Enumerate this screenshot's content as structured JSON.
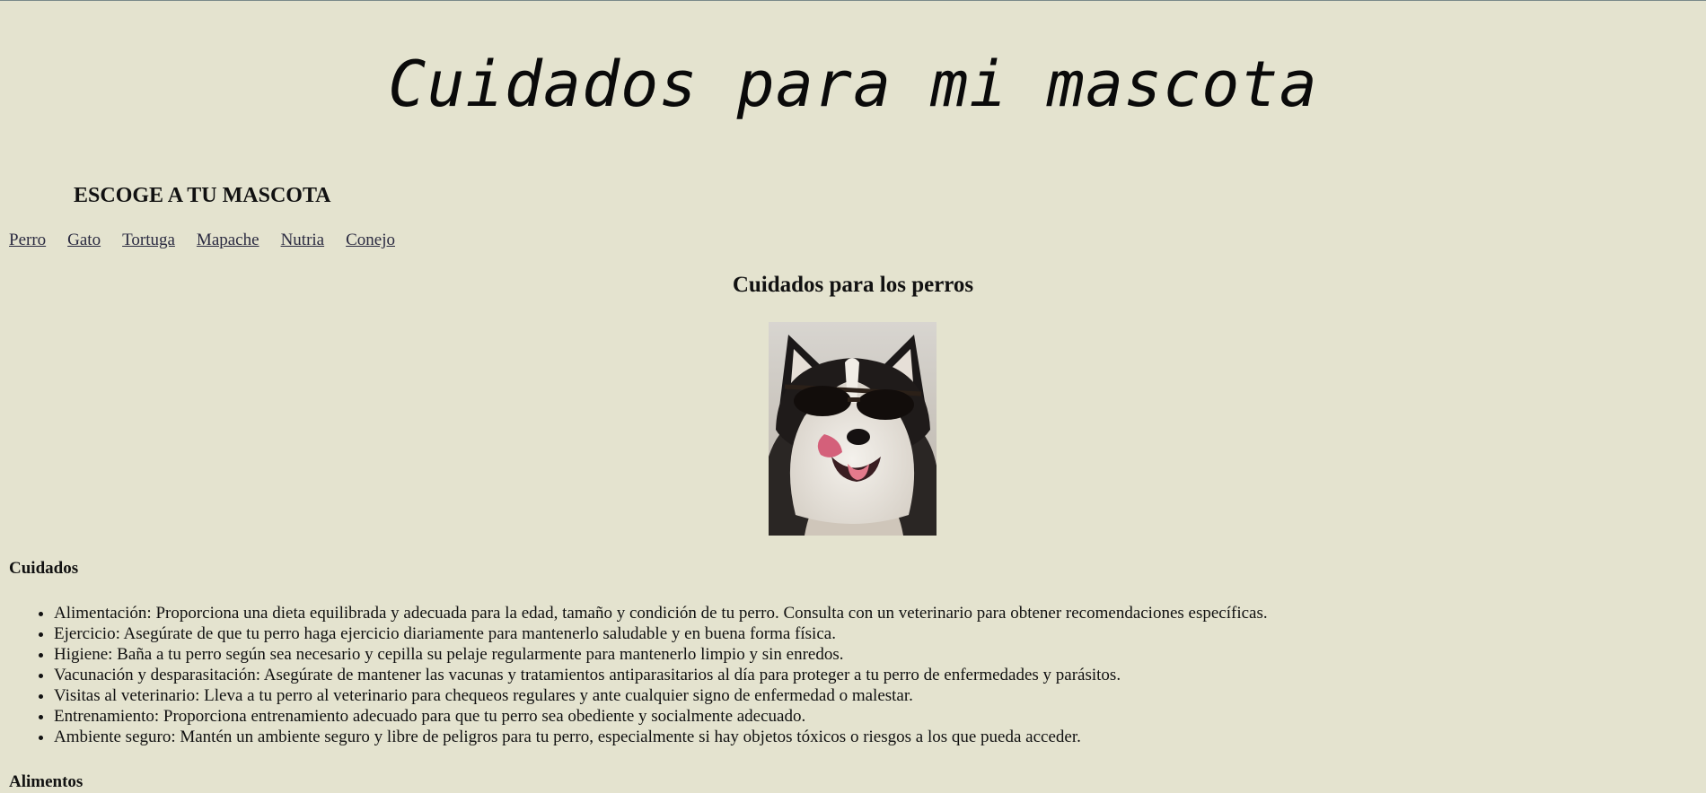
{
  "header": {
    "title": "Cuidados para mi mascota"
  },
  "chooser": {
    "heading": "ESCOGE A TU MASCOTA",
    "links": [
      "Perro",
      "Gato",
      "Tortuga",
      "Mapache",
      "Nutria",
      "Conejo"
    ]
  },
  "section": {
    "title": "Cuidados para los perros",
    "image_alt": "husky-with-sunglasses-photo",
    "care_heading": "Cuidados",
    "care_items": [
      "Alimentación: Proporciona una dieta equilibrada y adecuada para la edad, tamaño y condición de tu perro. Consulta con un veterinario para obtener recomendaciones específicas.",
      "Ejercicio: Asegúrate de que tu perro haga ejercicio diariamente para mantenerlo saludable y en buena forma física.",
      "Higiene: Baña a tu perro según sea necesario y cepilla su pelaje regularmente para mantenerlo limpio y sin enredos.",
      "Vacunación y desparasitación: Asegúrate de mantener las vacunas y tratamientos antiparasitarios al día para proteger a tu perro de enfermedades y parásitos.",
      "Visitas al veterinario: Lleva a tu perro al veterinario para chequeos regulares y ante cualquier signo de enfermedad o malestar.",
      "Entrenamiento: Proporciona entrenamiento adecuado para que tu perro sea obediente y socialmente adecuado.",
      "Ambiente seguro: Mantén un ambiente seguro y libre de peligros para tu perro, especialmente si hay objetos tóxicos o riesgos a los que pueda acceder."
    ],
    "food_heading": "Alimentos"
  },
  "colors": {
    "background": "#e4e3cf",
    "link": "#2a2a40",
    "text": "#111111"
  }
}
